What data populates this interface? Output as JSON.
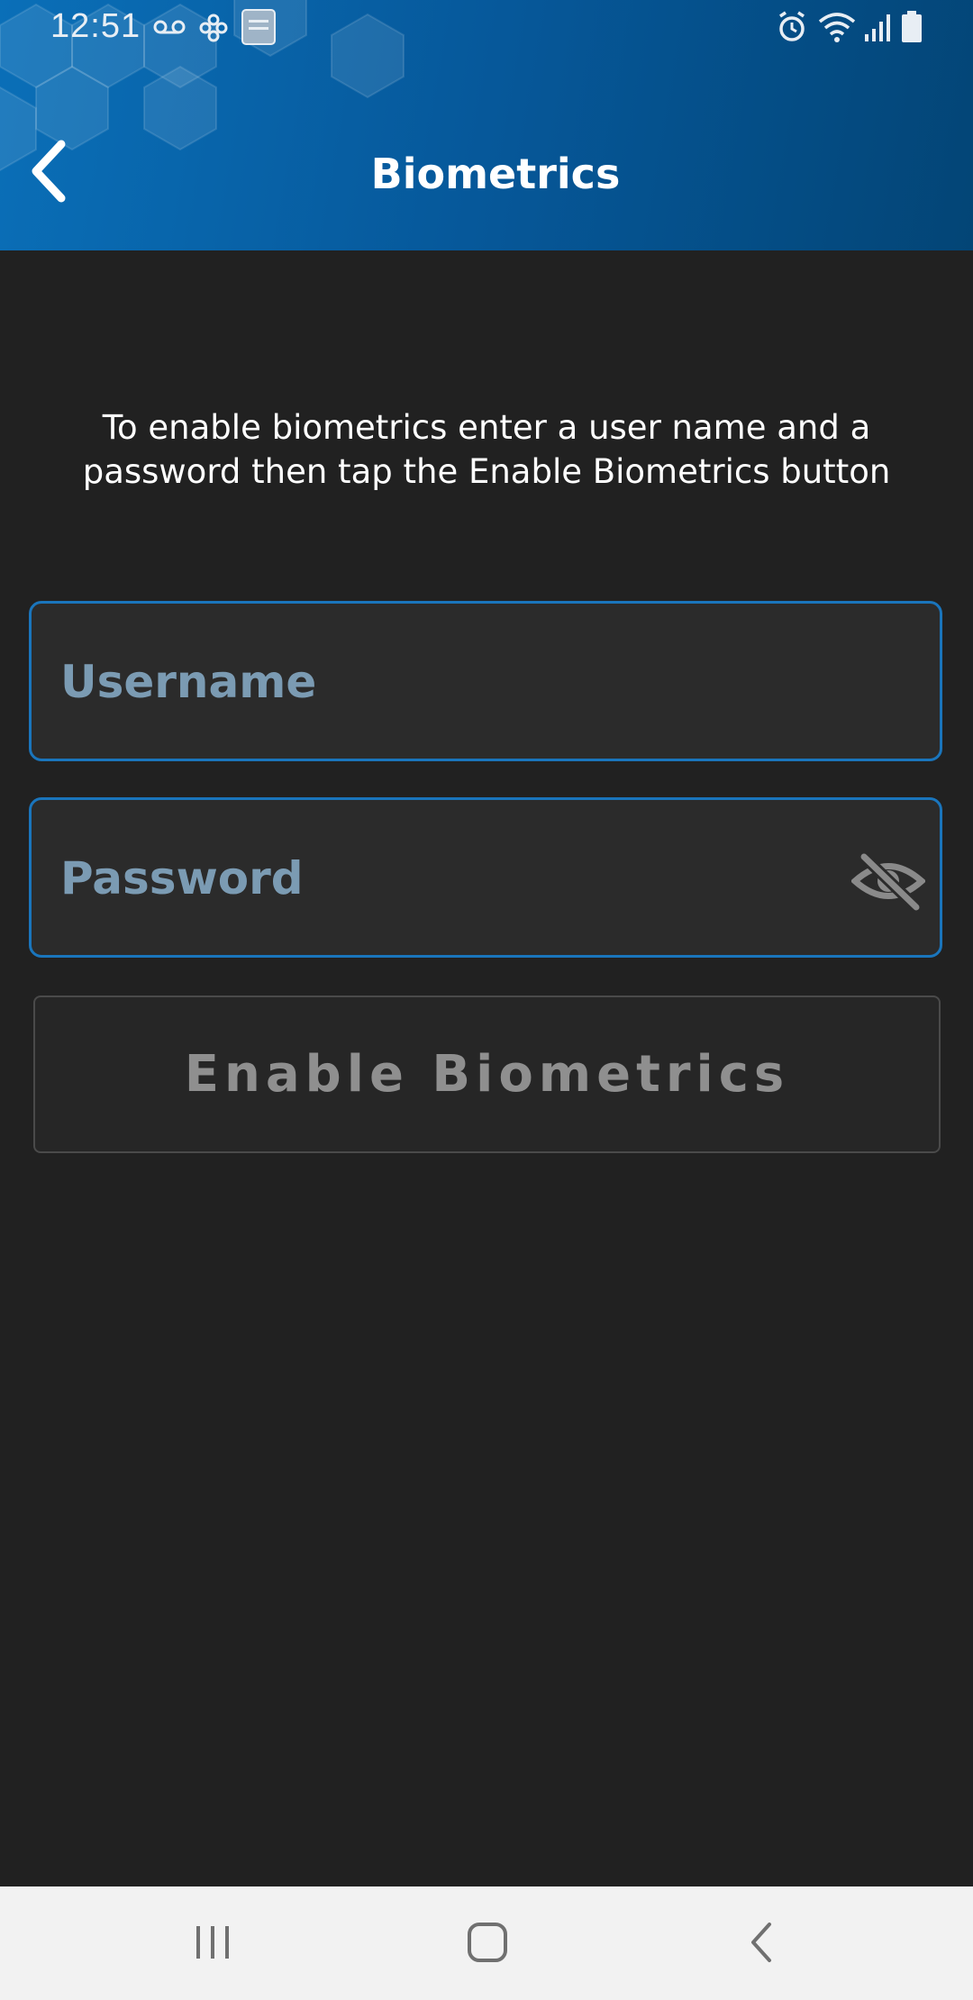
{
  "status_bar": {
    "time": "12:51",
    "left_icons": [
      "voicemail-icon",
      "pinwheel-icon",
      "bible-app-icon"
    ],
    "right_icons": [
      "alarm-icon",
      "wifi-icon",
      "signal-icon",
      "battery-icon"
    ]
  },
  "header": {
    "title": "Biometrics",
    "back_icon": "chevron-left-icon"
  },
  "instructions": "To enable biometrics enter a user name and a password then tap the Enable Biometrics button",
  "username_field": {
    "placeholder": "Username",
    "value": ""
  },
  "password_field": {
    "placeholder": "Password",
    "value": "",
    "toggle_icon": "eye-off-icon"
  },
  "enable_button": {
    "label": "Enable Biometrics",
    "state": "disabled"
  },
  "nav_bar": {
    "buttons": [
      "recent-apps",
      "home",
      "back"
    ]
  },
  "colors": {
    "header_blue": "#0a6fb8",
    "background": "#212121",
    "field_border": "#1a75bc",
    "placeholder": "#7b9bb3",
    "button_text_disabled": "#8f8f8f"
  }
}
